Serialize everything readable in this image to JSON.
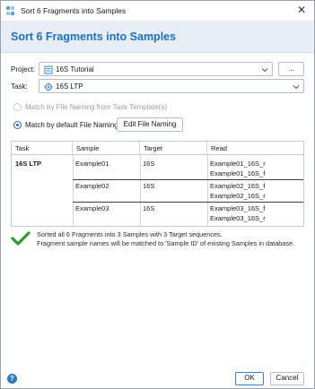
{
  "window": {
    "title": "Sort 6 Fragments into Samples",
    "heading": "Sort 6 Fragments into Samples"
  },
  "form": {
    "project_label": "Project:",
    "project_value": "16S Tutorial",
    "project_browse_label": "...",
    "task_label": "Task:",
    "task_value": "16S LTP"
  },
  "options": {
    "template_naming_label": "Match by File Naming from Task Template(s)",
    "template_naming_selected": false,
    "template_naming_enabled": false,
    "default_naming_label": "Match by default File Naming",
    "default_naming_selected": true,
    "edit_file_naming_label": "Edit File Naming"
  },
  "table": {
    "columns": [
      "Task",
      "Sample",
      "Target",
      "Read"
    ],
    "task": "16S LTP",
    "groups": [
      {
        "sample": "Example01",
        "target": "16S",
        "reads": [
          "Example01_16S_r",
          "Example01_16S_f"
        ]
      },
      {
        "sample": "Example02",
        "target": "16S",
        "reads": [
          "Example02_16S_f",
          "Example02_16S_r"
        ]
      },
      {
        "sample": "Example03",
        "target": "16S",
        "reads": [
          "Example03_16S_f",
          "Example03_16S_r"
        ]
      }
    ]
  },
  "status": {
    "line1": "Sorted all 6 Fragments into 3 Samples with 3 Target sequences.",
    "line2": "Fragment sample names will be matched to 'Sample ID' of existing Samples in database."
  },
  "footer": {
    "ok_label": "OK",
    "cancel_label": "Cancel",
    "help_glyph": "?"
  },
  "colors": {
    "accent": "#1f6fbf",
    "header_bg": "#e8eef5",
    "success": "#2e9b2e"
  },
  "icons": {
    "app": "app-grid-icon",
    "project": "project-list-icon",
    "task": "task-gear-icon",
    "status": "checkmark-icon",
    "help": "help-icon"
  }
}
